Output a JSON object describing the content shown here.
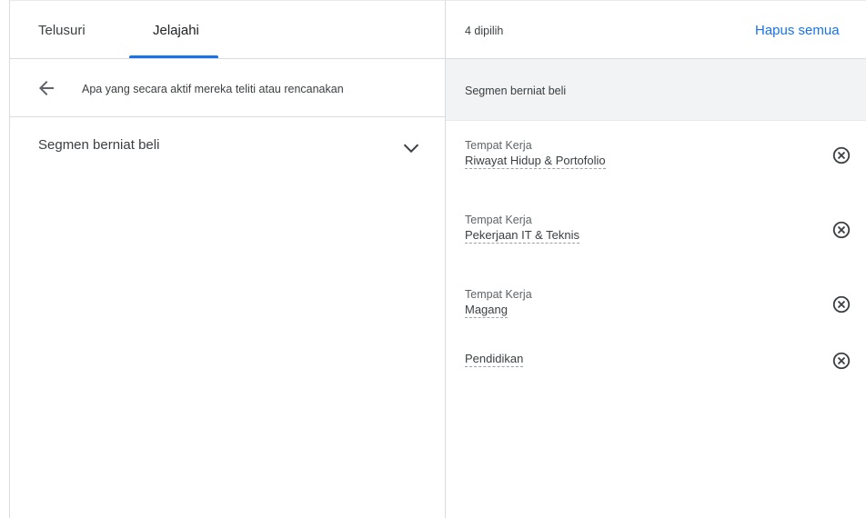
{
  "tabs": [
    {
      "label": "Telusuri"
    },
    {
      "label": "Jelajahi"
    }
  ],
  "accent_color": "#1a73e8",
  "breadcrumb": {
    "back_icon": "arrow-left-icon",
    "text": "Apa yang secara aktif mereka teliti atau rencanakan"
  },
  "category": {
    "label": "Segmen berniat beli",
    "icon": "chevron-down-icon"
  },
  "selection": {
    "count_label": "4 dipilih",
    "clear_all_label": "Hapus semua",
    "section_title": "Segmen berniat beli",
    "items": [
      {
        "parent": "Tempat Kerja",
        "name": "Riwayat Hidup & Portofolio"
      },
      {
        "parent": "Tempat Kerja",
        "name": "Pekerjaan IT & Teknis"
      },
      {
        "parent": "Tempat Kerja",
        "name": "Magang"
      },
      {
        "parent": "",
        "name": "Pendidikan"
      }
    ],
    "remove_icon": "remove-circle-icon"
  }
}
